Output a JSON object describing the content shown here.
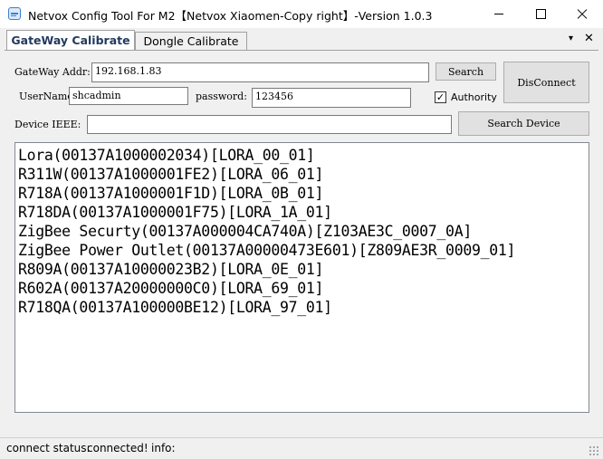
{
  "window": {
    "title": "Netvox Config Tool For M2【Netvox Xiaomen-Copy right】-Version 1.0.3",
    "app_icon": "config-tool-icon",
    "minimize_icon": "minimize-icon",
    "maximize_icon": "maximize-icon",
    "close_icon": "close-icon"
  },
  "tabs": {
    "items": [
      {
        "label": "GateWay Calibrate",
        "active": true
      },
      {
        "label": "Dongle Calibrate",
        "active": false
      }
    ],
    "dropdown_glyph": "▾",
    "close_glyph": "✕"
  },
  "form": {
    "gateway_addr_label": "GateWay Addr:",
    "gateway_addr_value": "192.168.1.83",
    "search_label": "Search",
    "disconnect_label": "DisConnect",
    "username_label": "UserName:",
    "username_value": "shcadmin",
    "password_label": "password:",
    "password_value": "123456",
    "authority_label": "Authority",
    "authority_checked": true,
    "device_ieee_label": "Device IEEE:",
    "device_ieee_value": "",
    "search_device_label": "Search Device"
  },
  "devices": [
    "Lora(00137A1000002034)[LORA_00_01]",
    "R311W(00137A1000001FE2)[LORA_06_01]",
    "R718A(00137A1000001F1D)[LORA_0B_01]",
    "R718DA(00137A1000001F75)[LORA_1A_01]",
    "ZigBee Securty(00137A000004CA740A)[Z103AE3C_0007_0A]",
    "ZigBee Power Outlet(00137A00000473E601)[Z809AE3R_0009_01]",
    "R809A(00137A10000023B2)[LORA_0E_01]",
    "R602A(00137A20000000C0)[LORA_69_01]",
    "R718QA(00137A100000BE12)[LORA_97_01]"
  ],
  "status": {
    "connect_label": "connect status:",
    "connect_value": "connected!",
    "info_label": "info:"
  }
}
